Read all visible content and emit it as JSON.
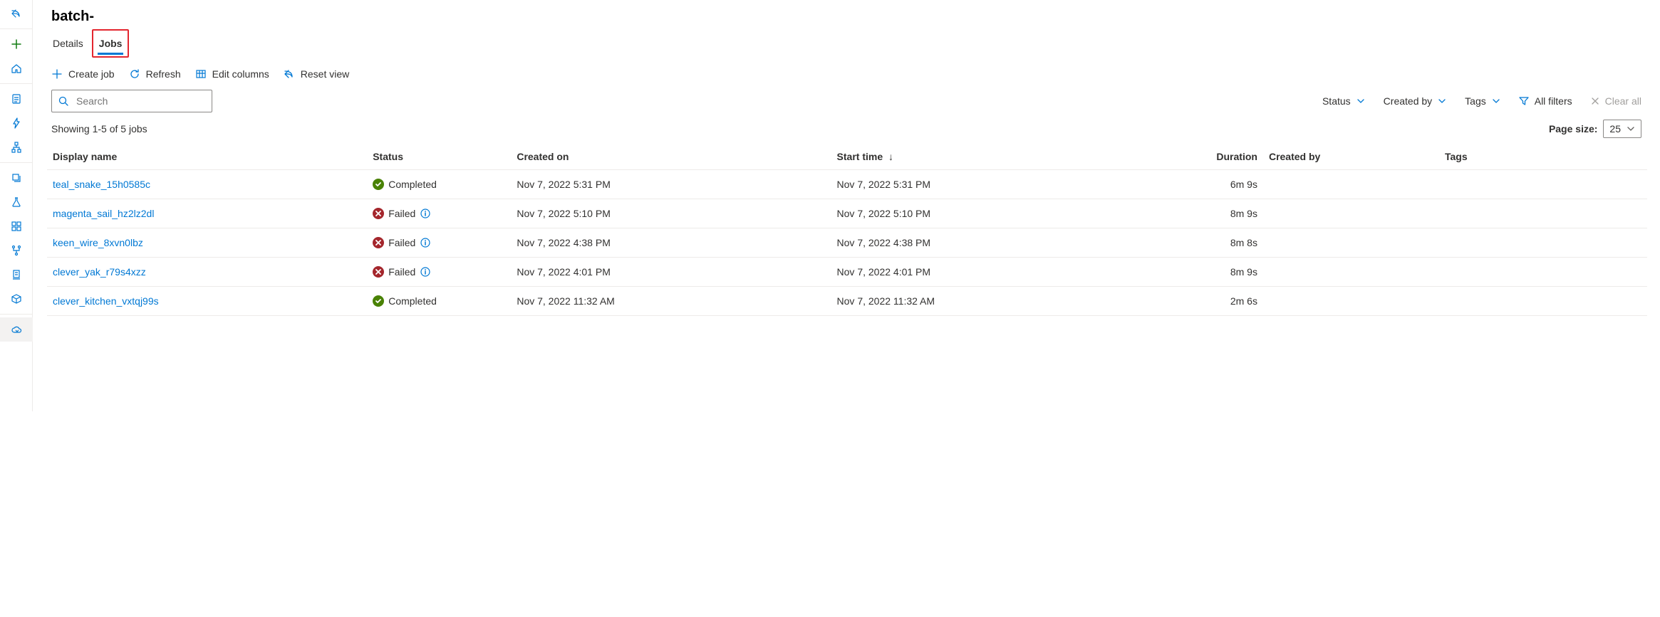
{
  "page_title": "batch-",
  "tabs": [
    {
      "label": "Details",
      "active": false
    },
    {
      "label": "Jobs",
      "active": true
    }
  ],
  "toolbar": {
    "create_job": "Create job",
    "refresh": "Refresh",
    "edit_columns": "Edit columns",
    "reset_view": "Reset view"
  },
  "search": {
    "placeholder": "Search"
  },
  "filters": {
    "status": "Status",
    "created_by": "Created by",
    "tags": "Tags",
    "all_filters": "All filters",
    "clear_all": "Clear all"
  },
  "results_summary": "Showing 1-5 of 5 jobs",
  "page_size": {
    "label": "Page size:",
    "value": "25"
  },
  "columns": {
    "display_name": "Display name",
    "status": "Status",
    "created_on": "Created on",
    "start_time": "Start time",
    "duration": "Duration",
    "created_by": "Created by",
    "tags": "Tags"
  },
  "rows": [
    {
      "display_name": "teal_snake_15h0585c",
      "status": "Completed",
      "status_kind": "completed",
      "created_on": "Nov 7, 2022 5:31 PM",
      "start_time": "Nov 7, 2022 5:31 PM",
      "duration": "6m 9s",
      "created_by": "",
      "tags": ""
    },
    {
      "display_name": "magenta_sail_hz2lz2dl",
      "status": "Failed",
      "status_kind": "failed",
      "created_on": "Nov 7, 2022 5:10 PM",
      "start_time": "Nov 7, 2022 5:10 PM",
      "duration": "8m 9s",
      "created_by": "",
      "tags": ""
    },
    {
      "display_name": "keen_wire_8xvn0lbz",
      "status": "Failed",
      "status_kind": "failed",
      "created_on": "Nov 7, 2022 4:38 PM",
      "start_time": "Nov 7, 2022 4:38 PM",
      "duration": "8m 8s",
      "created_by": "",
      "tags": ""
    },
    {
      "display_name": "clever_yak_r79s4xzz",
      "status": "Failed",
      "status_kind": "failed",
      "created_on": "Nov 7, 2022 4:01 PM",
      "start_time": "Nov 7, 2022 4:01 PM",
      "duration": "8m 9s",
      "created_by": "",
      "tags": ""
    },
    {
      "display_name": "clever_kitchen_vxtqj99s",
      "status": "Completed",
      "status_kind": "completed",
      "created_on": "Nov 7, 2022 11:32 AM",
      "start_time": "Nov 7, 2022 11:32 AM",
      "duration": "2m 6s",
      "created_by": "",
      "tags": ""
    }
  ]
}
